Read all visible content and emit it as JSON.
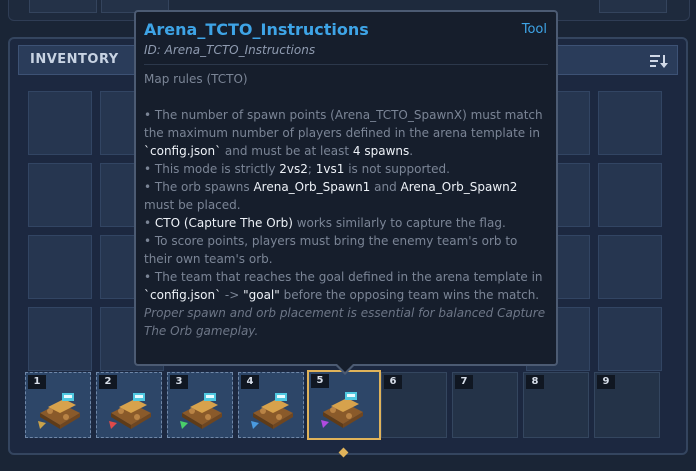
{
  "inventory": {
    "title": "INVENTORY",
    "sort_icon": "sort-icon"
  },
  "hotbar": {
    "slots": [
      {
        "number": "1",
        "filled": true,
        "accent": "#c9a24a"
      },
      {
        "number": "2",
        "filled": true,
        "accent": "#e04a4a"
      },
      {
        "number": "3",
        "filled": true,
        "accent": "#4ad06a"
      },
      {
        "number": "4",
        "filled": true,
        "accent": "#4a9ae0"
      },
      {
        "number": "5",
        "filled": true,
        "accent": "#b04ae0",
        "selected": true
      },
      {
        "number": "6",
        "filled": false
      },
      {
        "number": "7",
        "filled": false
      },
      {
        "number": "8",
        "filled": false
      },
      {
        "number": "9",
        "filled": false
      }
    ]
  },
  "tooltip": {
    "title": "Arena_TCTO_Instructions",
    "tag": "Tool",
    "id_line": "ID: Arena_TCTO_Instructions",
    "heading": "Map rules (TCTO)",
    "lines": {
      "l1a": "• The number of spawn points (Arena_TCTO_SpawnX) must match the maximum number of players defined in the arena template in ",
      "l1b": "`config.json`",
      "l1c": " and must be at least ",
      "l1d": "4 spawns",
      "l1e": ".",
      "l2a": "• This mode is strictly ",
      "l2b": "2vs2",
      "l2c": "; ",
      "l2d": "1vs1",
      "l2e": " is not supported.",
      "l3a": "• The orb spawns ",
      "l3b": "Arena_Orb_Spawn1",
      "l3c": " and ",
      "l3d": "Arena_Orb_Spawn2",
      "l3e": " must be placed.",
      "l4a": "• ",
      "l4b": "CTO (Capture The Orb)",
      "l4c": " works similarly to capture the flag.",
      "l5": "• To score points, players must bring the enemy team's orb to their own team's orb.",
      "l6a": "• The team that reaches the goal defined in the arena template in ",
      "l6b": "`config.json`",
      "l6c": " -> ",
      "l6d": "\"goal\"",
      "l6e": " before the opposing team wins the match."
    },
    "footer": "Proper spawn and orb placement is essential for balanced Capture The Orb gameplay."
  },
  "colors": {
    "title_blue": "#3ea4e6",
    "selected_border": "#e0b35a"
  }
}
